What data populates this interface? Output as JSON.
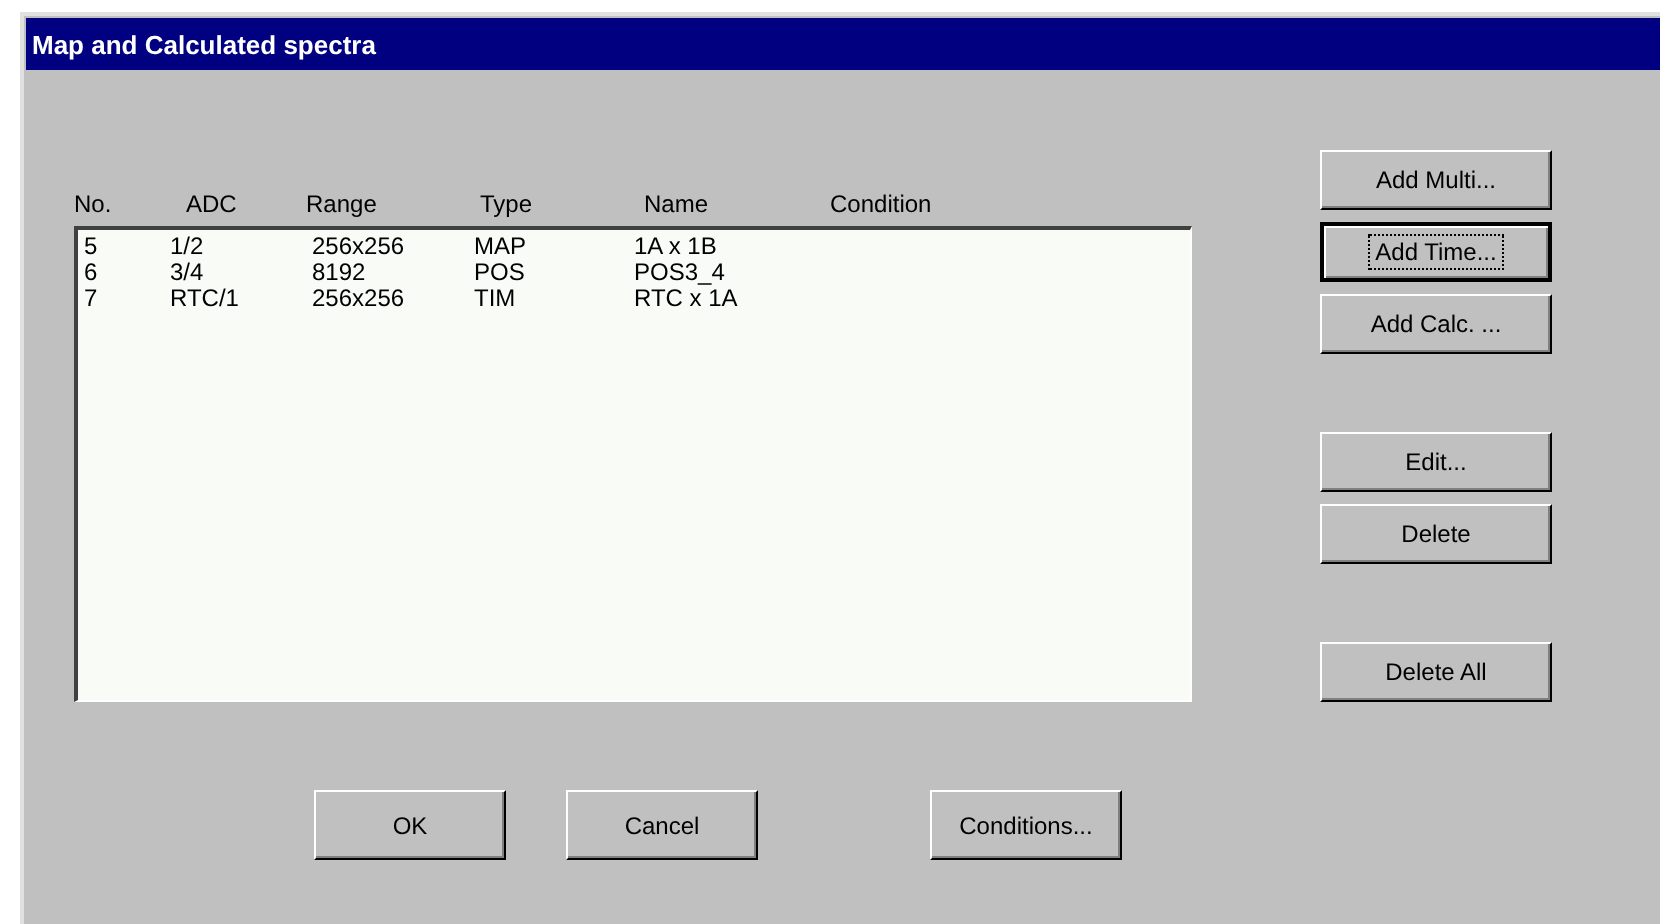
{
  "window": {
    "title": "Map and Calculated spectra"
  },
  "list": {
    "columns": [
      "No.",
      "ADC",
      "Range",
      "Type",
      "Name",
      "Condition"
    ],
    "rows": [
      {
        "cells": [
          "5",
          "1/2",
          "256x256",
          "MAP",
          "1A x 1B"
        ]
      },
      {
        "cells": [
          "6",
          "3/4",
          "8192",
          "POS",
          "POS3_4"
        ]
      },
      {
        "cells": [
          "7",
          "RTC/1",
          "256x256",
          "TIM",
          "RTC x 1A"
        ]
      }
    ]
  },
  "side_buttons": [
    {
      "label": "Add Multi...",
      "focused": false
    },
    {
      "label": "Add Time...",
      "focused": true
    },
    {
      "label": "Add Calc. ...",
      "focused": false
    },
    {
      "label": "Edit...",
      "focused": false
    },
    {
      "label": "Delete",
      "focused": false
    },
    {
      "label": "Delete All",
      "focused": false
    }
  ],
  "bottom_buttons": [
    {
      "label": "OK",
      "focused": false
    },
    {
      "label": "Cancel",
      "focused": false
    },
    {
      "label": "Conditions...",
      "focused": false
    }
  ]
}
